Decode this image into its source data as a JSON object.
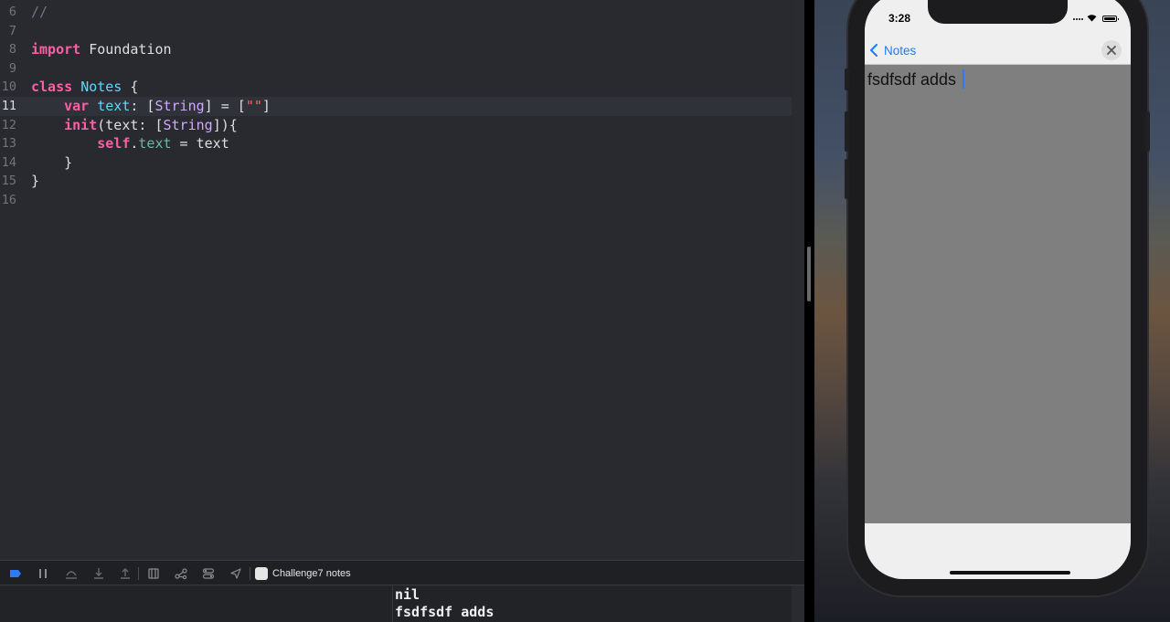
{
  "editor": {
    "lines": [
      {
        "num": "6",
        "tokens": [
          {
            "t": "//",
            "c": "cmt"
          }
        ]
      },
      {
        "num": "7",
        "tokens": []
      },
      {
        "num": "8",
        "tokens": [
          {
            "t": "import",
            "c": "kw"
          },
          {
            "t": " Foundation",
            "c": ""
          }
        ]
      },
      {
        "num": "9",
        "tokens": []
      },
      {
        "num": "10",
        "tokens": [
          {
            "t": "class",
            "c": "kw"
          },
          {
            "t": " ",
            "c": ""
          },
          {
            "t": "Notes",
            "c": "ty"
          },
          {
            "t": " {",
            "c": ""
          }
        ]
      },
      {
        "num": "11",
        "current": true,
        "tokens": [
          {
            "t": "    ",
            "c": ""
          },
          {
            "t": "var",
            "c": "kw"
          },
          {
            "t": " ",
            "c": ""
          },
          {
            "t": "text",
            "c": "ty"
          },
          {
            "t": ": [",
            "c": ""
          },
          {
            "t": "String",
            "c": "tyo"
          },
          {
            "t": "] = [",
            "c": ""
          },
          {
            "t": "\"\"",
            "c": "str"
          },
          {
            "t": "]",
            "c": ""
          }
        ]
      },
      {
        "num": "12",
        "tokens": [
          {
            "t": "    ",
            "c": ""
          },
          {
            "t": "init",
            "c": "kw"
          },
          {
            "t": "(text: [",
            "c": ""
          },
          {
            "t": "String",
            "c": "tyo"
          },
          {
            "t": "]){",
            "c": ""
          }
        ]
      },
      {
        "num": "13",
        "tokens": [
          {
            "t": "        ",
            "c": ""
          },
          {
            "t": "self",
            "c": "kw"
          },
          {
            "t": ".",
            "c": ""
          },
          {
            "t": "text",
            "c": "prop"
          },
          {
            "t": " = text",
            "c": ""
          }
        ]
      },
      {
        "num": "14",
        "tokens": [
          {
            "t": "    }",
            "c": ""
          }
        ]
      },
      {
        "num": "15",
        "tokens": [
          {
            "t": "}",
            "c": ""
          }
        ]
      },
      {
        "num": "16",
        "tokens": []
      }
    ]
  },
  "debugbar": {
    "scheme_label": "Challenge7 notes",
    "icons": [
      "breakpoints-icon",
      "pause-icon",
      "step-over-icon",
      "step-into-icon",
      "step-out-icon",
      "view-hierarchy-icon",
      "memory-graph-icon",
      "environment-overrides-icon",
      "location-icon"
    ]
  },
  "console": {
    "lines": [
      "nil",
      "fsdfsdf adds"
    ]
  },
  "simulator": {
    "time": "3:28",
    "back_label": "Notes",
    "note_text": "fsdfsdf adds",
    "colors": {
      "accent": "#1a7cf5",
      "caret": "#3478f6",
      "textview_bg": "#7f7f7f"
    }
  }
}
